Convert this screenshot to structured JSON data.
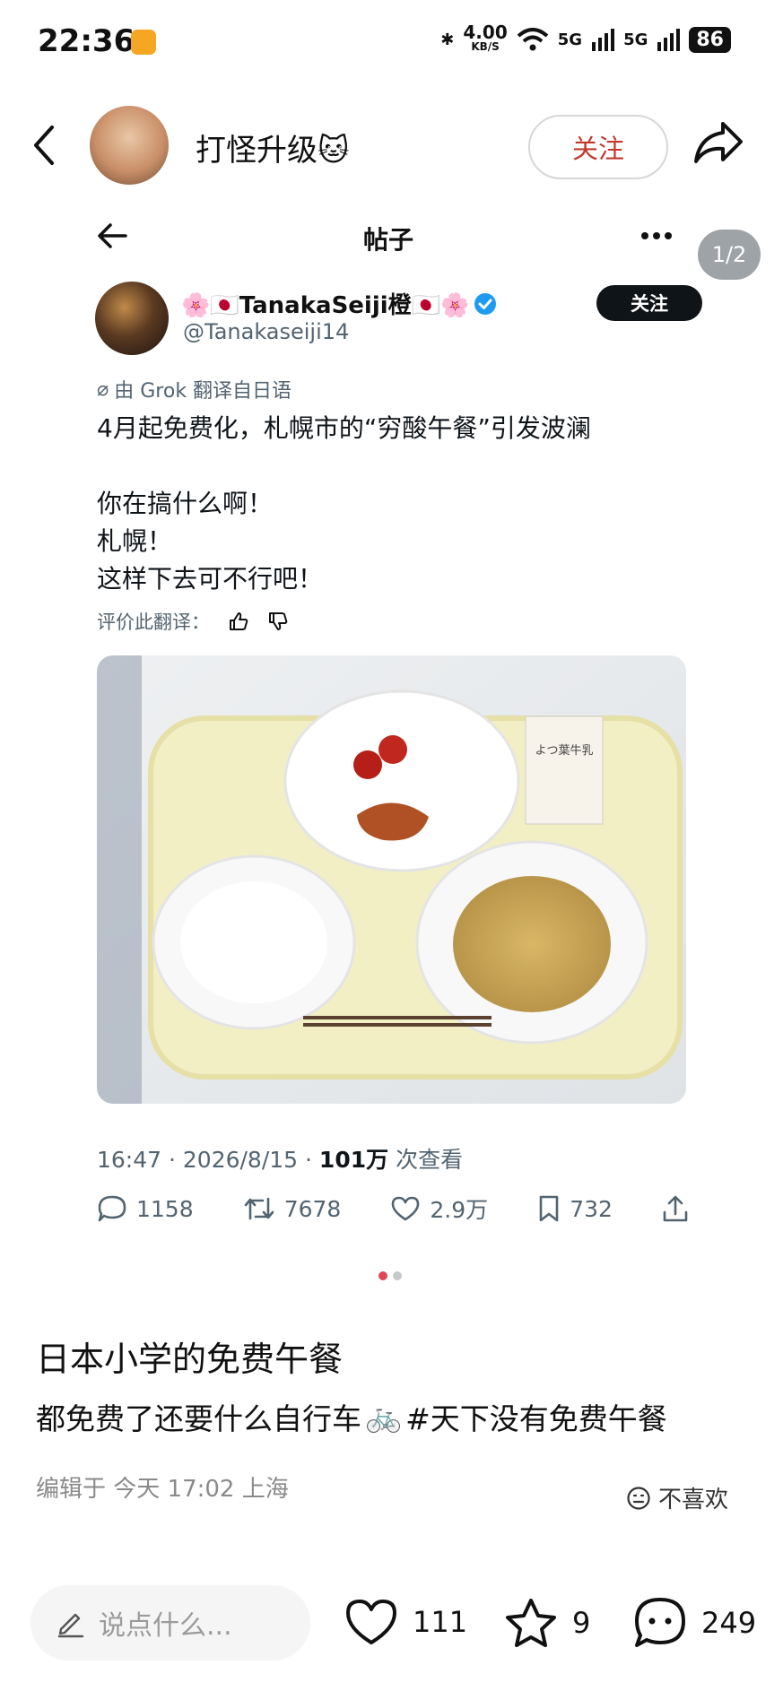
{
  "status_bar": {
    "time": "22:36",
    "net_speed": "4.00",
    "net_unit": "KB/S",
    "sig1": "5G",
    "sig2": "5G",
    "battery": "86"
  },
  "header": {
    "title": "打怪升级🐱",
    "follow_label": "关注"
  },
  "tweet": {
    "title": "帖子",
    "page_indicator": "1/2",
    "author_name": "🌸🇯🇵TanakaSeiji橙🇯🇵🌸",
    "handle": "@Tanakaseiji14",
    "follow_label": "关注",
    "translate_note": "由 Grok 翻译自日语",
    "lines": [
      "4月起免费化，札幌市的“穷酸午餐”引发波澜",
      "你在搞什么啊！",
      "札幌！",
      "这样下去可不行吧！"
    ],
    "rate_label": "评价此翻译：",
    "time": "16:47 · 2026/8/15 ·",
    "views_num": "101万",
    "views_label": "次查看",
    "replies": "1158",
    "retweets": "7678",
    "likes": "2.9万",
    "bookmarks": "732",
    "photo_text": "よつ葉牛乳"
  },
  "post": {
    "title": "日本小学的免费午餐",
    "desc_prefix": "都免费了还要什么自行车",
    "desc_emoji": "🚲",
    "desc_suffix": "#天下没有免费午餐",
    "edit_meta": "编辑于  今天 17:02  上海",
    "dislike_label": "不喜欢"
  },
  "bottom_bar": {
    "comment_placeholder": "说点什么...",
    "likes": "111",
    "stars": "9",
    "comments": "249"
  },
  "colors": {
    "accent": "#e0485a",
    "follow_red": "#c0392b",
    "verified": "#1d9bf0"
  }
}
